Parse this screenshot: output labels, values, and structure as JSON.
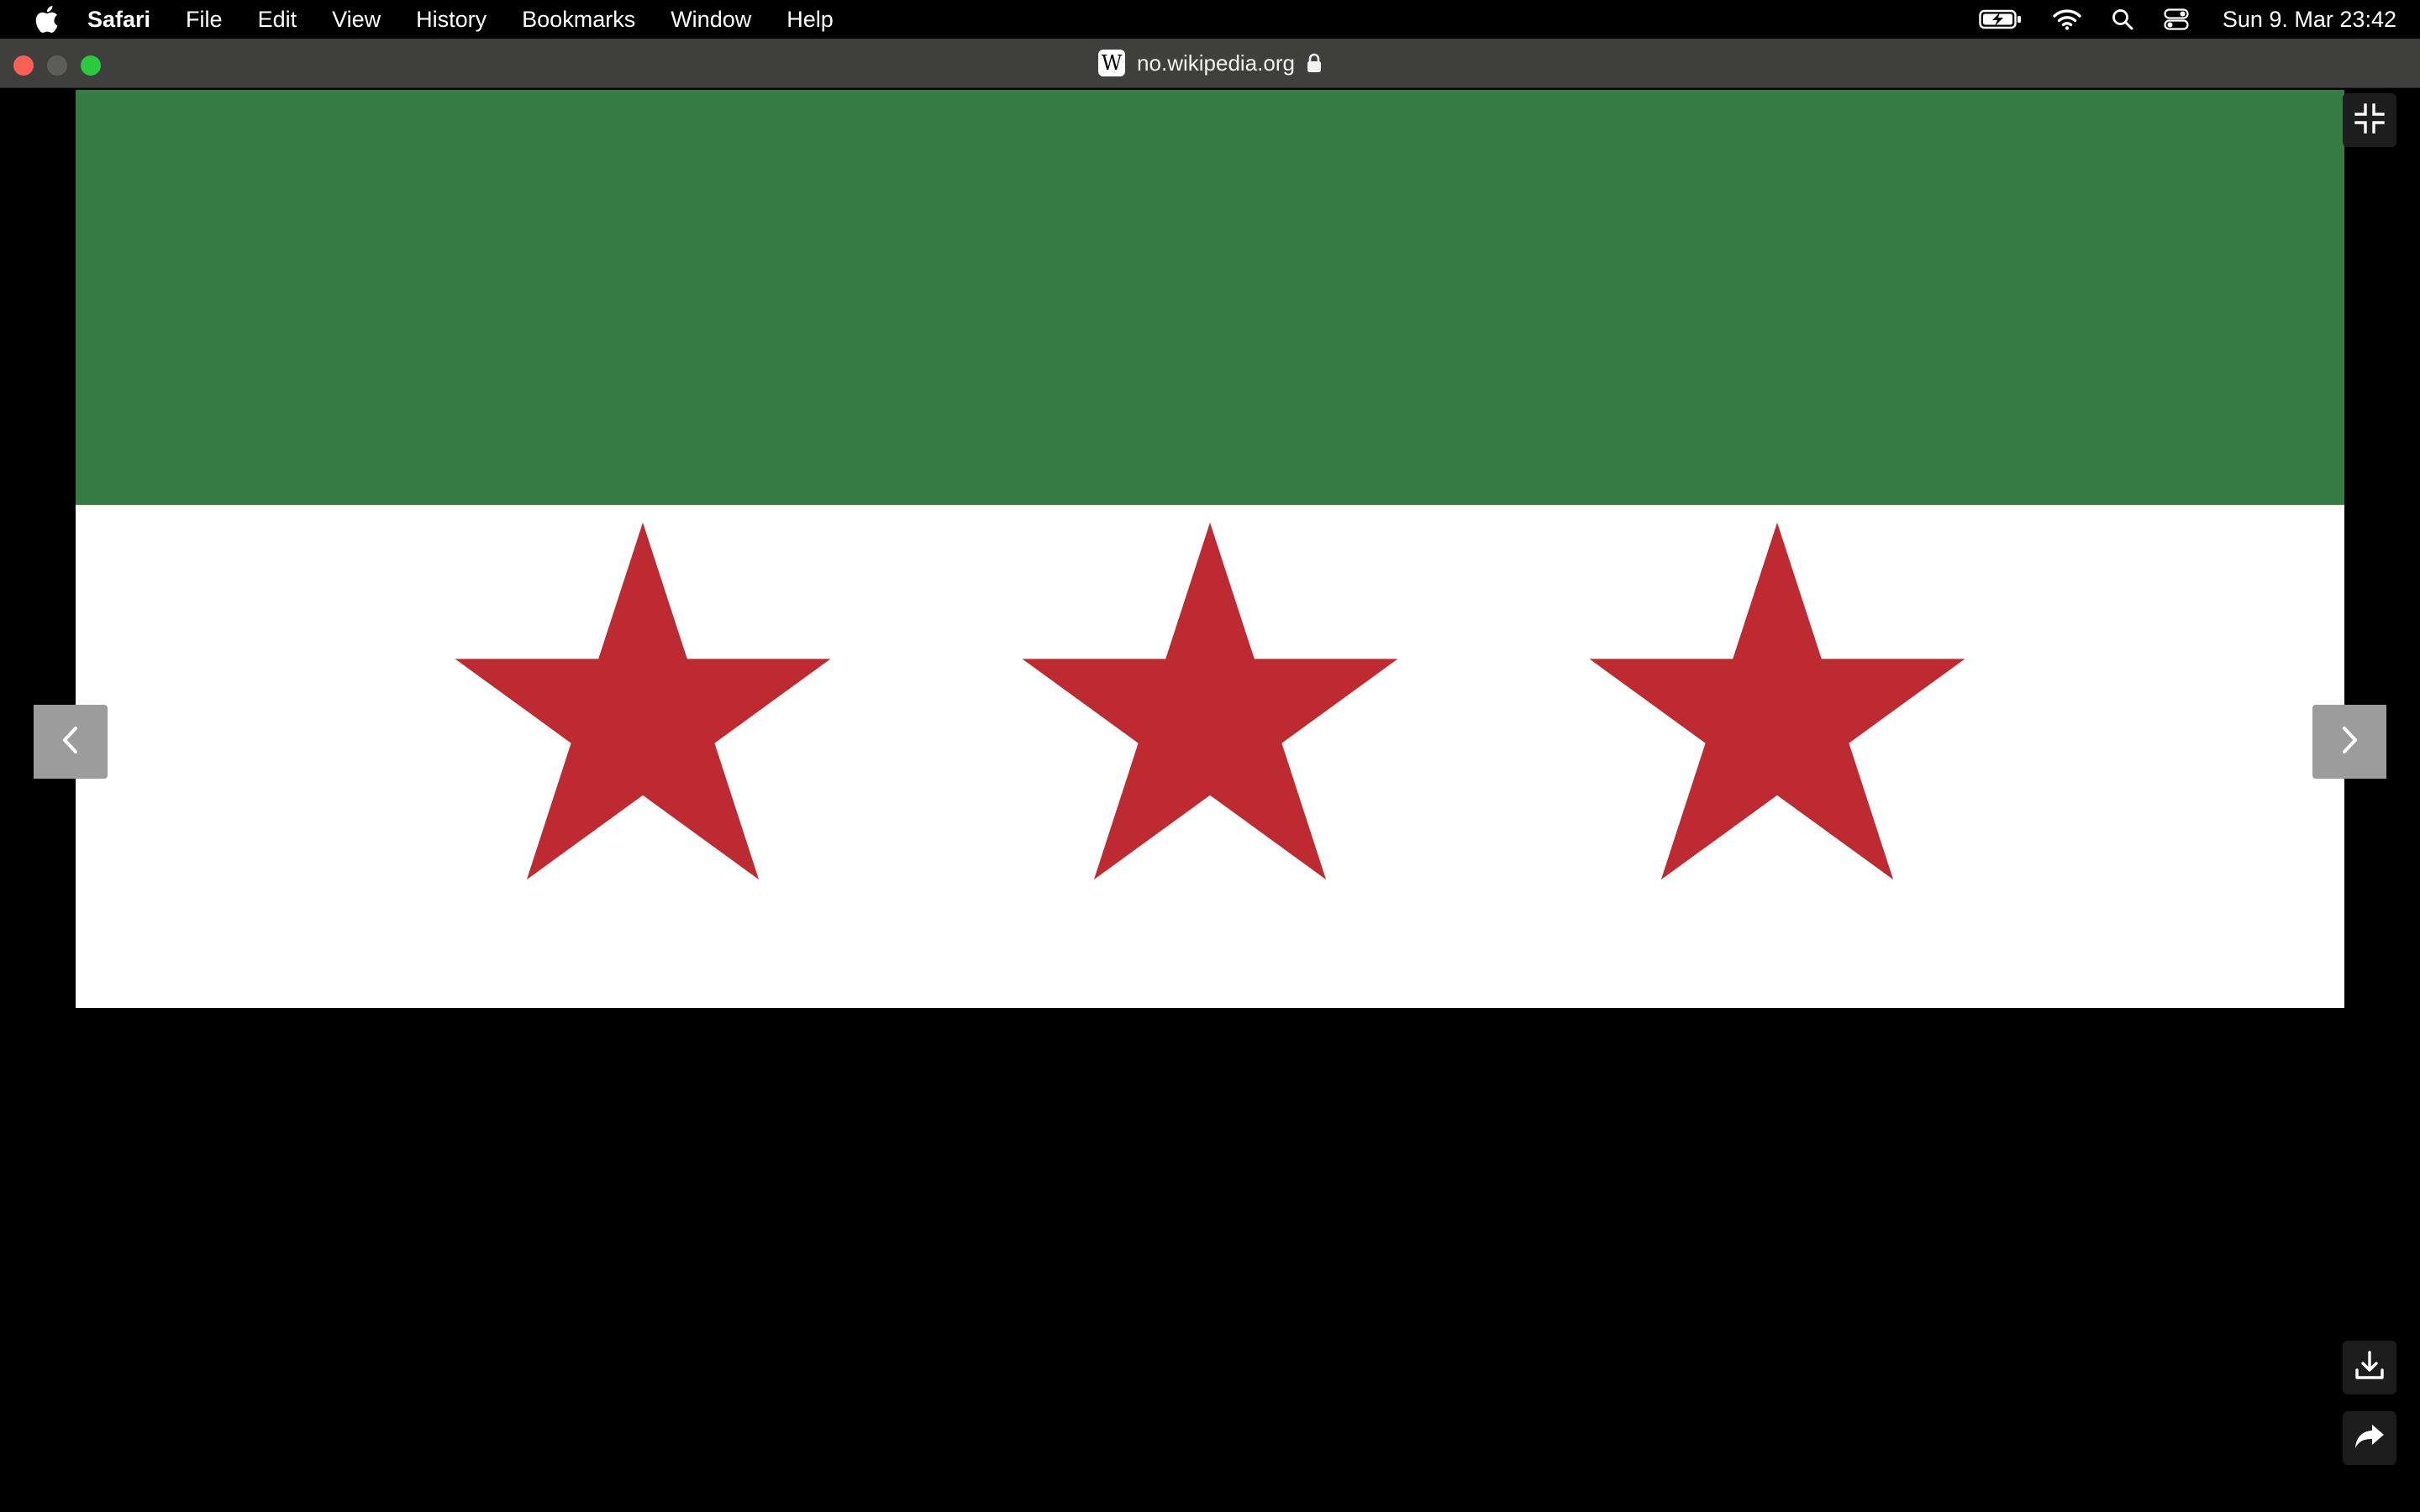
{
  "menubar": {
    "apple_icon": "apple-logo-icon",
    "items": [
      {
        "label": "Safari",
        "bold": true
      },
      {
        "label": "File"
      },
      {
        "label": "Edit"
      },
      {
        "label": "View"
      },
      {
        "label": "History"
      },
      {
        "label": "Bookmarks"
      },
      {
        "label": "Window"
      },
      {
        "label": "Help"
      }
    ],
    "status_icons": [
      "battery-charging-icon",
      "wifi-icon",
      "spotlight-search-icon",
      "control-center-icon"
    ],
    "clock": "Sun 9. Mar  23:42"
  },
  "window": {
    "favicon_letter": "W",
    "url": "no.wikipedia.org",
    "secure": true
  },
  "viewer": {
    "image": {
      "kind": "flag",
      "bands": [
        {
          "color": "#367b43"
        },
        {
          "color": "#ffffff"
        }
      ],
      "star_color": "#bd2a31",
      "star_count": 3
    },
    "prev_icon": "chevron-left-icon",
    "next_icon": "chevron-right-icon",
    "tools": [
      "exit-fullscreen-icon",
      "download-icon",
      "share-icon"
    ]
  }
}
